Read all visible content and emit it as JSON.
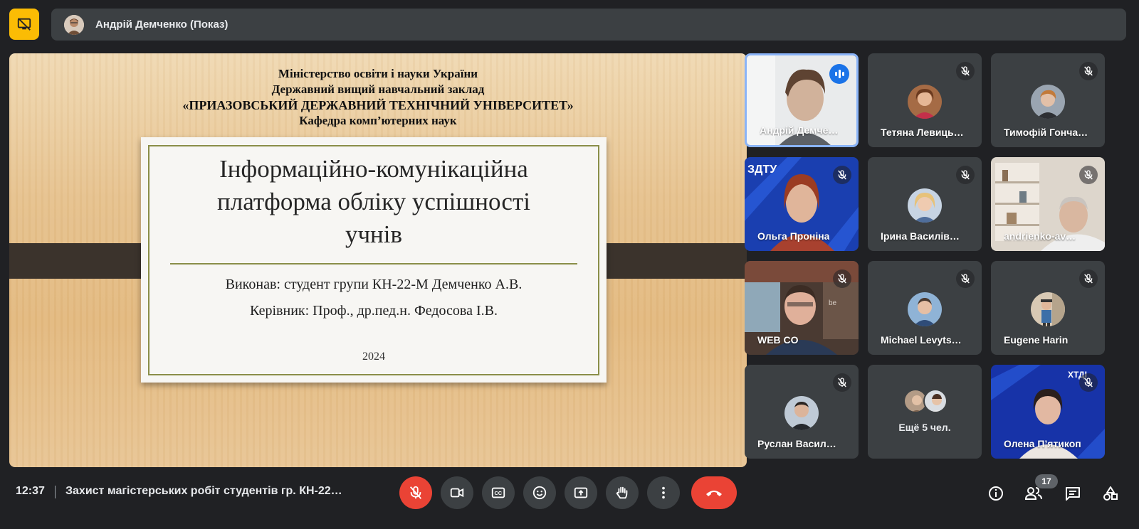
{
  "presentation": {
    "presenter_label": "Андрій Демченко (Показ)",
    "badge_icon": "presentation-off-icon"
  },
  "slide": {
    "header": [
      "Міністерство освіти і науки України",
      "Державний вищий навчальний заклад",
      "«ПРИАЗОВСЬКИЙ ДЕРЖАВНИЙ ТЕХНІЧНИЙ УНІВЕРСИТЕТ»",
      "Кафедра комп’ютерних наук"
    ],
    "title_lines": [
      "Інформаційно-комунікаційна",
      "платформа обліку успішності",
      "учнів"
    ],
    "author": "Виконав: студент групи КН-22-М Демченко А.В.",
    "supervisor": "Керівник: Проф., др.пед.н. Федосова І.В.",
    "year": "2024"
  },
  "participants": [
    {
      "name": "Андрій Демче…",
      "state": "speaking"
    },
    {
      "name": "Тетяна Левиць…",
      "state": "muted"
    },
    {
      "name": "Тимофій Гонча…",
      "state": "muted"
    },
    {
      "name": "Ольга Проніна",
      "state": "muted"
    },
    {
      "name": "Ірина Василів…",
      "state": "muted"
    },
    {
      "name": "andrienko-av…",
      "state": "muted"
    },
    {
      "name": "WEB CO",
      "state": "muted"
    },
    {
      "name": "Michael Levyts…",
      "state": "muted"
    },
    {
      "name": "Eugene Harin",
      "state": "muted"
    },
    {
      "name": "Руслан Васил…",
      "state": "muted"
    },
    {
      "name": "Ещё 5 чел.",
      "state": "group"
    },
    {
      "name": "Олена П’ятикоп",
      "state": "muted"
    }
  ],
  "bottom_bar": {
    "time": "12:37",
    "meeting_title": "Захист магістерських робіт студентів гр. КН-22…",
    "participant_count": "17"
  },
  "colors": {
    "background": "#202124",
    "surface": "#3c4043",
    "accent_yellow": "#fbbc04",
    "danger_red": "#ea4335",
    "speaking_blue": "#1a73e8",
    "active_border": "#8ab4f8"
  }
}
